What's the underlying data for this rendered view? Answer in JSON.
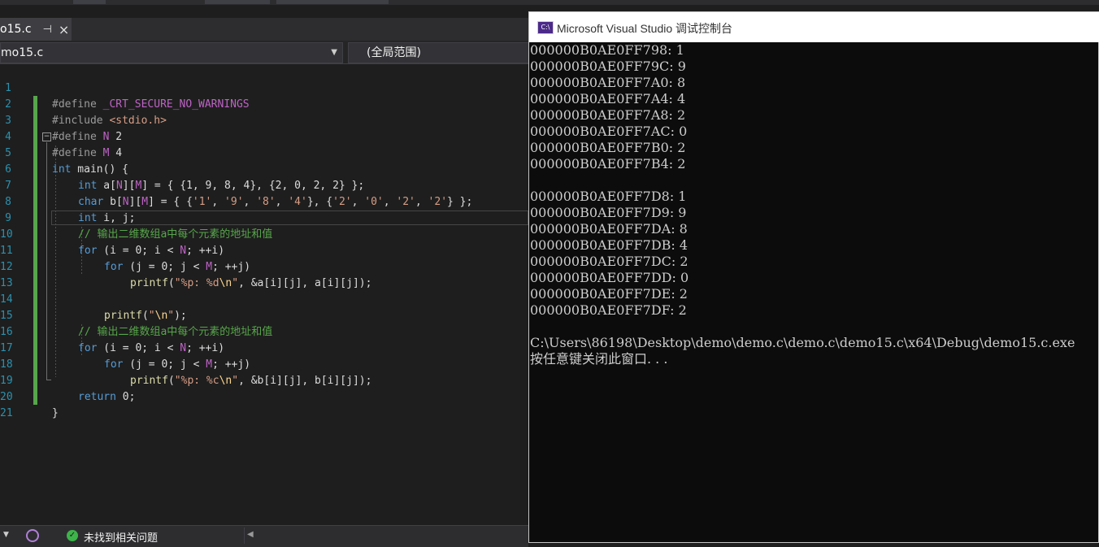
{
  "colors": {
    "editor_bg": "#1e1e1e",
    "keyword": "#569cd6",
    "comment": "#57a64a",
    "macro": "#bd63c5",
    "string": "#d69d85",
    "console_bg": "#0c0c0c"
  },
  "editor": {
    "tab": {
      "title": "o15.c",
      "pin": "⊣",
      "close": "×"
    },
    "nav": {
      "file_scope": "mo15.c",
      "global_scope": "(全局范围)"
    },
    "line_numbers": [
      "1",
      "2",
      "3",
      "4",
      "5",
      "6",
      "7",
      "8",
      "9",
      "10",
      "11",
      "12",
      "13",
      "14",
      "15",
      "16",
      "17",
      "18",
      "19",
      "20",
      "21"
    ],
    "lines": {
      "l1": {
        "a": "#define ",
        "b": "_CRT_SECURE_NO_WARNINGS"
      },
      "l2": {
        "a": "#include ",
        "b": "<stdio.h>"
      },
      "l3": {
        "a": "#define ",
        "b": "N",
        "c": " 2"
      },
      "l4": {
        "a": "#define ",
        "b": "M",
        "c": " 4"
      },
      "l5": {
        "a": "int",
        "b": " main() {"
      },
      "l6": {
        "a": "int",
        "b": " a[",
        "c": "N",
        "d": "][",
        "e": "M",
        "f": "] = { {1, 9, 8, 4}, {2, 0, 2, 2} };"
      },
      "l7": {
        "a": "char",
        "b": " b[",
        "c": "N",
        "d": "][",
        "e": "M",
        "f": "] = { {",
        "g": "'1'",
        "h": ", ",
        "i": "'9'",
        "j": ", ",
        "k": "'8'",
        "l": ", ",
        "m": "'4'",
        "n": "}, {",
        "o": "'2'",
        "p": ", ",
        "q": "'0'",
        "r": ", ",
        "s": "'2'",
        "t": ", ",
        "u": "'2'",
        "v": "} };"
      },
      "l8": {
        "a": "int",
        "b": " i, j;"
      },
      "l9": {
        "a": "// 输出二维数组a中每个元素的地址和值"
      },
      "l10": {
        "a": "for",
        "b": " (i = 0; i < ",
        "c": "N",
        "d": "; ++i)"
      },
      "l11": {
        "a": "for",
        "b": " (j = 0; j < ",
        "c": "M",
        "d": "; ++j)"
      },
      "l12": {
        "a": "printf",
        "b": "(",
        "c": "\"%p: %d",
        "d": "\\n",
        "e": "\"",
        "f": ", &a[i][j], a[i][j]);"
      },
      "l14": {
        "a": "printf",
        "b": "(",
        "c": "\"",
        "d": "\\n",
        "e": "\"",
        "f": ");"
      },
      "l15": {
        "a": "// 输出二维数组a中每个元素的地址和值"
      },
      "l16": {
        "a": "for",
        "b": " (i = 0; i < ",
        "c": "N",
        "d": "; ++i)"
      },
      "l17": {
        "a": "for",
        "b": " (j = 0; j < ",
        "c": "M",
        "d": "; ++j)"
      },
      "l18": {
        "a": "printf",
        "b": "(",
        "c": "\"%p: %c",
        "d": "\\n",
        "e": "\"",
        "f": ", &b[i][j], b[i][j]);"
      },
      "l19": {
        "a": "return",
        "b": " 0;"
      },
      "l20": {
        "a": "}"
      }
    },
    "status": {
      "message": "未找到相关问题"
    }
  },
  "console": {
    "title": "Microsoft Visual Studio 调试控制台",
    "icon_text": "C:\\",
    "lines": [
      "000000B0AE0FF798: 1",
      "000000B0AE0FF79C: 9",
      "000000B0AE0FF7A0: 8",
      "000000B0AE0FF7A4: 4",
      "000000B0AE0FF7A8: 2",
      "000000B0AE0FF7AC: 0",
      "000000B0AE0FF7B0: 2",
      "000000B0AE0FF7B4: 2",
      "",
      "000000B0AE0FF7D8: 1",
      "000000B0AE0FF7D9: 9",
      "000000B0AE0FF7DA: 8",
      "000000B0AE0FF7DB: 4",
      "000000B0AE0FF7DC: 2",
      "000000B0AE0FF7DD: 0",
      "000000B0AE0FF7DE: 2",
      "000000B0AE0FF7DF: 2",
      "",
      "C:\\Users\\86198\\Desktop\\demo\\demo.c\\demo.c\\demo15.c\\x64\\Debug\\demo15.c.exe",
      "按任意键关闭此窗口. . ."
    ]
  }
}
